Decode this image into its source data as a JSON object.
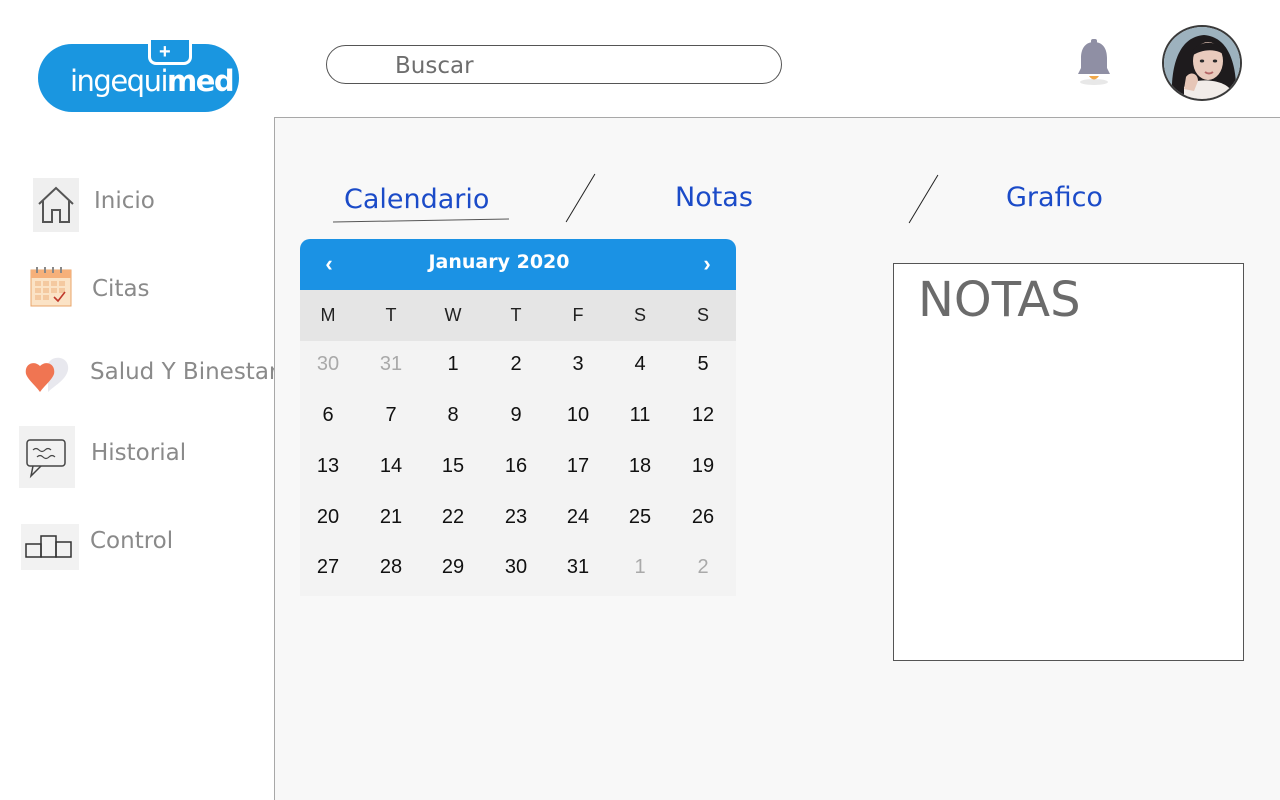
{
  "logo": {
    "text_light": "ingequi",
    "text_bold": "med",
    "plus": "+"
  },
  "search": {
    "placeholder": "Buscar",
    "value": ""
  },
  "header": {
    "bell_icon": "bell-icon",
    "avatar": "user-avatar"
  },
  "sidebar": {
    "items": [
      {
        "label": "Inicio",
        "icon": "home-icon"
      },
      {
        "label": "Citas",
        "icon": "calendar-icon"
      },
      {
        "label": "Salud Y Binestar",
        "icon": "heart-icon"
      },
      {
        "label": "Historial",
        "icon": "chat-history-icon"
      },
      {
        "label": "Control",
        "icon": "bar-chart-icon"
      }
    ]
  },
  "tabs": {
    "calendario": "Calendario",
    "notas": "Notas",
    "grafico": "Grafico"
  },
  "calendar": {
    "title": "January 2020",
    "prev": "‹",
    "next": "›",
    "weekdays": [
      "M",
      "T",
      "W",
      "T",
      "F",
      "S",
      "S"
    ],
    "weeks": [
      [
        "30",
        "31",
        "1",
        "2",
        "3",
        "4",
        "5"
      ],
      [
        "6",
        "7",
        "8",
        "9",
        "10",
        "11",
        "12"
      ],
      [
        "13",
        "14",
        "15",
        "16",
        "17",
        "18",
        "19"
      ],
      [
        "20",
        "21",
        "22",
        "23",
        "24",
        "25",
        "26"
      ],
      [
        "27",
        "28",
        "29",
        "30",
        "31",
        "1",
        "2"
      ]
    ]
  },
  "notes": {
    "title": "NOTAS"
  },
  "colors": {
    "accent": "#1b92e4",
    "tab_text": "#1b4bc8",
    "logo": "#1a96e0"
  }
}
